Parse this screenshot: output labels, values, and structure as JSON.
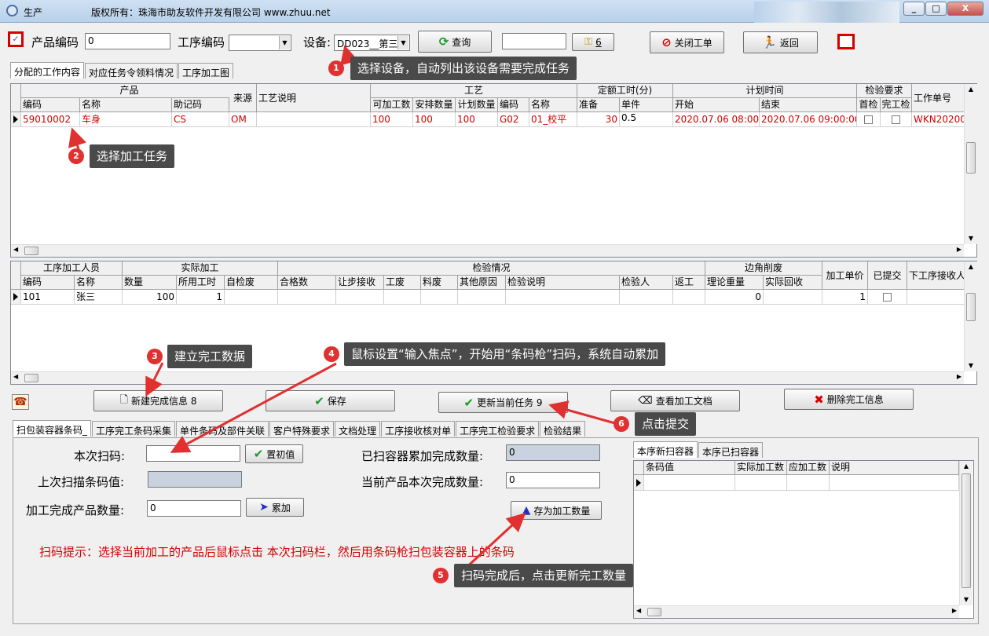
{
  "window": {
    "title": "生产",
    "copyright": "版权所有：珠海市助友软件开发有限公司 www.zhuu.net",
    "minimize": "_",
    "maximize": "□",
    "close": "X"
  },
  "toolbar": {
    "product_code_label": "产品编码",
    "product_code_value": "0",
    "process_code_label": "工序编码",
    "process_code_value": "",
    "device_label": "设备:",
    "device_value": "DD023__第三",
    "query_label": "查询",
    "search_value": "",
    "count_label": "6",
    "close_order_label": "关闭工单",
    "back_label": "返回"
  },
  "top_tabs": [
    "分配的工作内容",
    "对应任务令领料情况",
    "工序加工图"
  ],
  "task_grid": {
    "groups": [
      "产品",
      "来源",
      "工艺说明",
      "工艺",
      "定额工时(分)",
      "计划时间",
      "检验要求",
      "工作单号"
    ],
    "columns": [
      "编码",
      "名称",
      "助记码",
      "可加工数",
      "安排数量",
      "计划数量",
      "编码",
      "名称",
      "准备",
      "单件",
      "开始",
      "结束",
      "首检",
      "完工检"
    ],
    "row": {
      "code": "59010002",
      "name": "车身",
      "mnemonic": "CS",
      "source": "OM",
      "process_note": "",
      "processable": "100",
      "arranged": "100",
      "planned": "100",
      "proc_code": "G02",
      "proc_name": "01_校平",
      "prep": "30",
      "unit": "0.5",
      "start": "2020.07.06 08:00:0",
      "end": "2020.07.06 09:00:00",
      "order_no": "WKN20200"
    }
  },
  "worker_grid": {
    "groups": [
      "工序加工人员",
      "实际加工",
      "检验情况",
      "边角削废",
      "加工单价",
      "已提交",
      "下工序接收人"
    ],
    "columns": [
      "编码",
      "名称",
      "数量",
      "所用工时",
      "自检废",
      "合格数",
      "让步接收",
      "工废",
      "料废",
      "其他原因",
      "检验说明",
      "检验人",
      "返工",
      "理论重量",
      "实际回收"
    ],
    "row": {
      "code": "101",
      "name": "张三",
      "qty": "100",
      "hours": "1",
      "theory_weight": "0",
      "unit_price": "1"
    }
  },
  "actions": {
    "new_info": "新建完成信息 8",
    "save": "保存",
    "update_task": "更新当前任务 9",
    "view_doc": "查看加工文档",
    "delete_info": "删除完工信息"
  },
  "bottom_tabs": [
    "扫包装容器条码_",
    "工序完工条码采集",
    "单件条码及部件关联",
    "客户特殊要求",
    "文档处理",
    "工序接收核对单",
    "工序完工检验要求",
    "检验结果"
  ],
  "scan": {
    "this_scan_label": "本次扫码:",
    "this_scan_value": "",
    "reset_label": "置初值",
    "last_scan_label": "上次扫描条码值:",
    "last_scan_value": "",
    "done_qty_label": "加工完成产品数量:",
    "done_qty_value": "0",
    "accumulate_label": "累加",
    "container_total_label": "已扫容器累加完成数量:",
    "container_total_value": "0",
    "current_qty_label": "当前产品本次完成数量:",
    "current_qty_value": "0",
    "save_qty_label": "存为加工数量",
    "hint": "扫码提示：选择当前加工的产品后鼠标点击 本次扫码栏，然后用条码枪扫包装容器上的条码"
  },
  "container_tabs": [
    "本序新扫容器",
    "本序已扫容器"
  ],
  "container_grid": {
    "columns": [
      "条码值",
      "实际加工数",
      "应加工数",
      "说明"
    ]
  },
  "callouts": [
    {
      "num": "1",
      "text": "选择设备，自动列出该设备需要完成任务"
    },
    {
      "num": "2",
      "text": "选择加工任务"
    },
    {
      "num": "3",
      "text": "建立完工数据"
    },
    {
      "num": "4",
      "text": "鼠标设置“输入焦点”，开始用“条码枪”扫码，系统自动累加"
    },
    {
      "num": "5",
      "text": "扫码完成后，点击更新完工数量"
    },
    {
      "num": "6",
      "text": "点击提交"
    }
  ]
}
